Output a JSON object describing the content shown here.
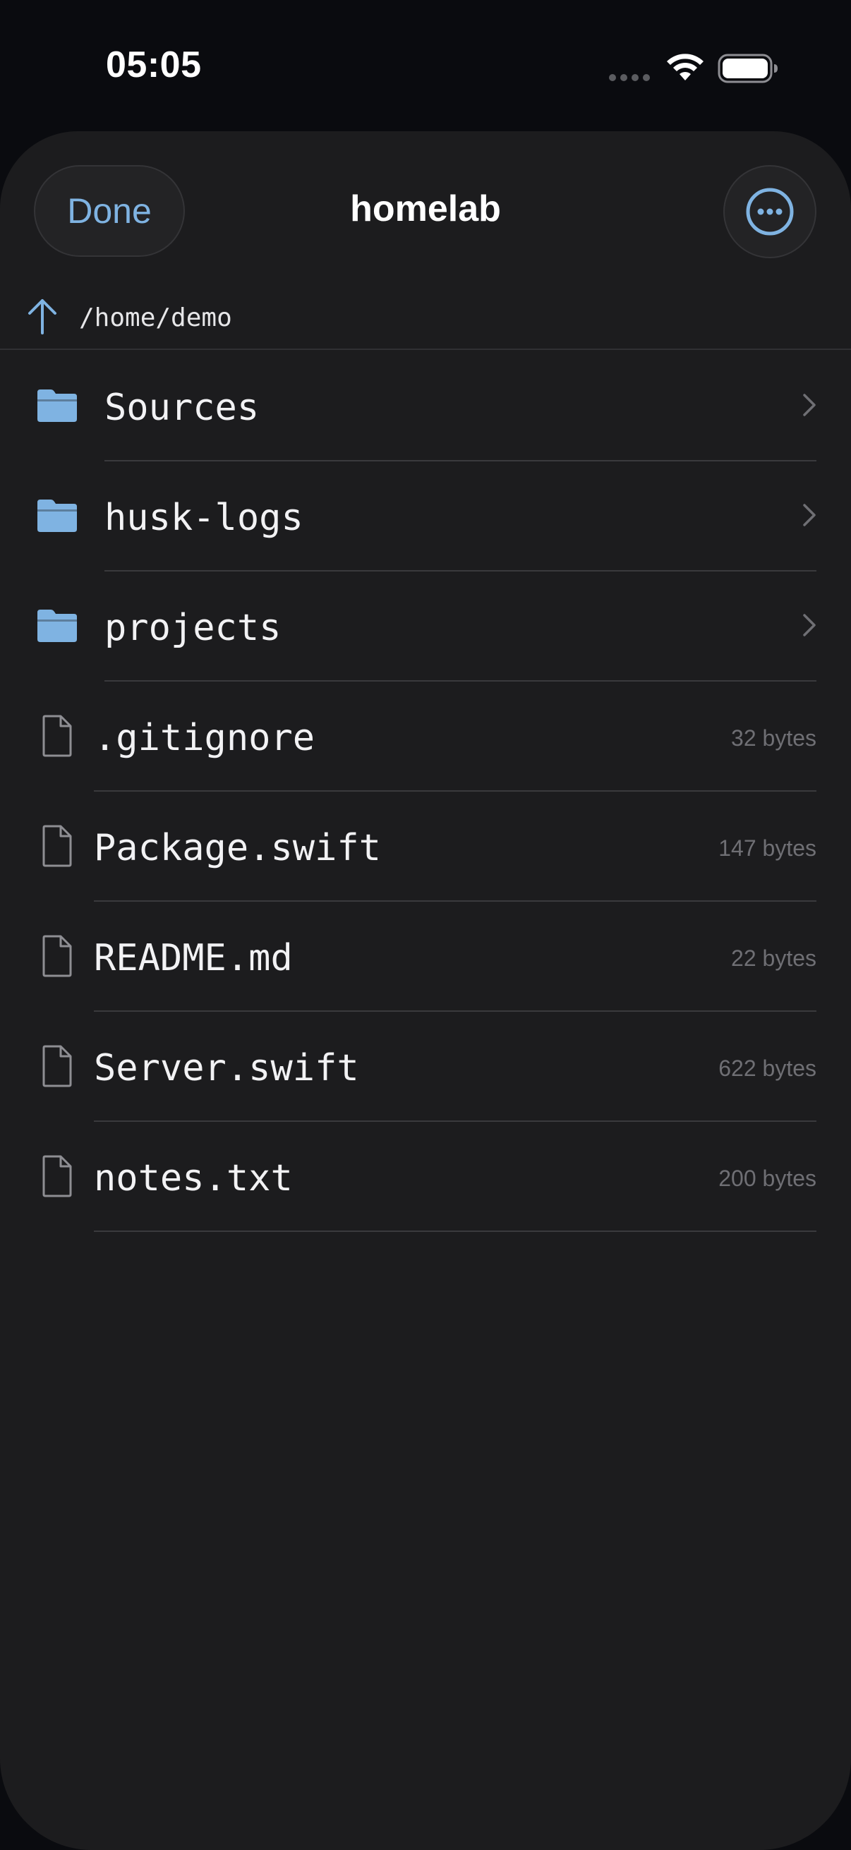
{
  "status_bar": {
    "time": "05:05"
  },
  "header": {
    "done_label": "Done",
    "title": "homelab",
    "more_icon": "ellipsis-circle-icon"
  },
  "path": {
    "icon": "arrow-up-icon",
    "label": "/home/demo"
  },
  "items": [
    {
      "name": "Sources",
      "type": "folder",
      "size": ""
    },
    {
      "name": "husk-logs",
      "type": "folder",
      "size": ""
    },
    {
      "name": "projects",
      "type": "folder",
      "size": ""
    },
    {
      "name": ".gitignore",
      "type": "file",
      "size": "32 bytes"
    },
    {
      "name": "Package.swift",
      "type": "file",
      "size": "147 bytes"
    },
    {
      "name": "README.md",
      "type": "file",
      "size": "22 bytes"
    },
    {
      "name": "Server.swift",
      "type": "file",
      "size": "622 bytes"
    },
    {
      "name": "notes.txt",
      "type": "file",
      "size": "200 bytes"
    }
  ],
  "colors": {
    "accent": "#7fb3e2",
    "background": "#1c1c1e",
    "folder": "#7fb3e2"
  }
}
